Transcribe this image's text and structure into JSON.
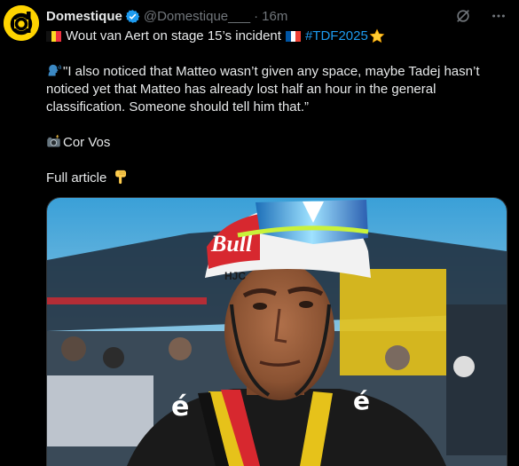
{
  "author": {
    "name": "Domestique",
    "handle": "@Domestique___",
    "separator": "·",
    "time": "16m",
    "verified": true,
    "avatar_icon": "domestique-logo-icon",
    "avatar_color": "#ffd400"
  },
  "tweet": {
    "headline": "Wout van Aert on stage 15’s incident",
    "hashtag": "#TDF2025",
    "quote": "\"I also noticed that Matteo wasn’t given any space, maybe Tadej hasn’t noticed yet that Matteo has already lost half an hour in the general classification. Someone should tell him that.”",
    "photo_credit": "Cor Vos",
    "cta": "Full article",
    "emojis": [
      "belgium-flag",
      "france-flag",
      "star-icon",
      "speaking-head-icon",
      "camera-flash-icon",
      "pointing-down-icon"
    ]
  },
  "actions": {
    "icons": [
      "grok-icon",
      "more-icon"
    ]
  },
  "colors": {
    "background": "#000000",
    "text": "#e7e9ea",
    "secondary": "#71767b",
    "link": "#1d9bf0",
    "verified": "#1d9bf0"
  }
}
